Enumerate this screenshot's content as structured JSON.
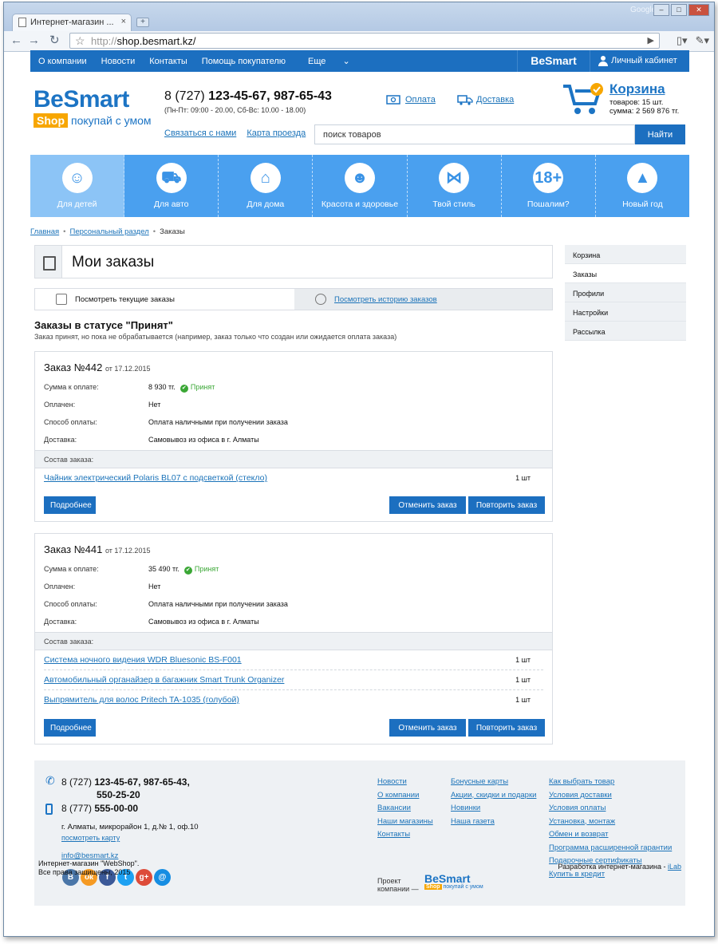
{
  "browser": {
    "tab_title": "Интернет-магазин ...",
    "profile": "Google",
    "url_protocol": "http://",
    "url_host": "shop.besmart.kz/"
  },
  "topnav": {
    "links": [
      "О компании",
      "Новости",
      "Контакты",
      "Помощь покупателю",
      "Еще"
    ],
    "brand": "BeSmart",
    "cabinet": "Личный кабинет"
  },
  "header": {
    "logo_main": "BeSmart",
    "logo_shop": "Shop",
    "logo_tagline": "покупай с умом",
    "phone_prefix": "8 (727)",
    "phone_numbers": "123-45-67, 987-65-43",
    "hours": "(Пн-Пт: 09:00 - 20.00, Сб-Вс: 10.00 - 18.00)",
    "contact_link": "Связаться с нами",
    "map_link": "Карта проезда",
    "payment_link": "Оплата",
    "delivery_link": "Доставка",
    "cart_title": "Корзина",
    "cart_count": "товаров: 15 шт.",
    "cart_sum": "сумма: 2 569 876 тг.",
    "search_placeholder": "поиск товаров",
    "search_button": "Найти"
  },
  "categories": [
    {
      "label": "Для детей",
      "icon": "baby-icon"
    },
    {
      "label": "Для авто",
      "icon": "car-icon"
    },
    {
      "label": "Для дома",
      "icon": "house-icon"
    },
    {
      "label": "Красота и здоровье",
      "icon": "beauty-icon"
    },
    {
      "label": "Твой стиль",
      "icon": "bowtie-icon"
    },
    {
      "label": "Пошалим?",
      "icon": "18plus-icon",
      "glyph": "18+"
    },
    {
      "label": "Новый год",
      "icon": "christmas-tree-icon"
    }
  ],
  "breadcrumb": [
    "Главная",
    "Персональный раздел",
    "Заказы"
  ],
  "page": {
    "title": "Мои заказы",
    "tab_current": "Посмотреть текущие заказы",
    "tab_history": "Посмотреть историю заказов",
    "status_title": "Заказы в статусе \"Принят\"",
    "status_desc": "Заказ принят, но пока не обрабатывается (например, заказ только что создан или ожидается оплата заказа)"
  },
  "order_labels": {
    "sum": "Сумма к оплате:",
    "paid": "Оплачен:",
    "method": "Способ оплаты:",
    "delivery": "Доставка:",
    "composition": "Состав заказа:",
    "details_button": "Подробнее",
    "cancel_button": "Отменить заказ",
    "repeat_button": "Повторить заказ"
  },
  "orders": [
    {
      "number": "Заказ №442",
      "date": "от 17.12.2015",
      "sum": "8 930 тг.",
      "status": "Принят",
      "paid": "Нет",
      "method": "Оплата наличными при получении заказа",
      "delivery": "Самовывоз из офиса в г. Алматы",
      "items": [
        {
          "name": "Чайник электрический Polaris BL07 с подсветкой (стекло)",
          "qty": "1 шт"
        }
      ]
    },
    {
      "number": "Заказ №441",
      "date": "от 17.12.2015",
      "sum": "35 490 тг.",
      "status": "Принят",
      "paid": "Нет",
      "method": "Оплата наличными при получении заказа",
      "delivery": "Самовывоз из офиса в г. Алматы",
      "items": [
        {
          "name": "Система ночного видения WDR Bluesonic BS-F001",
          "qty": "1 шт"
        },
        {
          "name": "Автомобильный органайзер в багажник Smart Trunk Organizer",
          "qty": "1 шт"
        },
        {
          "name": "Выпрямитель для волос Pritech TA-1035 (голубой)",
          "qty": "1 шт"
        }
      ]
    }
  ],
  "sidebar": [
    "Корзина",
    "Заказы",
    "Профили",
    "Настройки",
    "Рассылка"
  ],
  "footer": {
    "phone1_prefix": "8 (727)",
    "phone1_numbers": "123-45-67, 987-65-43,",
    "phone1_extra": "550-25-20",
    "phone2_prefix": "8 (777)",
    "phone2_number": "555-00-00",
    "address": "г. Алматы, микрорайон 1, д.№ 1, оф.10",
    "map_link": "посмотреть карту",
    "email": "info@besmart.kz",
    "socials": [
      {
        "name": "vk",
        "glyph": "В",
        "color": "#4a76a8"
      },
      {
        "name": "odnoklassniki",
        "glyph": "ок",
        "color": "#f59a23"
      },
      {
        "name": "facebook",
        "glyph": "f",
        "color": "#3b5998"
      },
      {
        "name": "twitter",
        "glyph": "t",
        "color": "#1da1f2"
      },
      {
        "name": "google-plus",
        "glyph": "g+",
        "color": "#dd4b39"
      },
      {
        "name": "mail",
        "glyph": "@",
        "color": "#168de2"
      }
    ],
    "col1": [
      "Новости",
      "О компании",
      "Вакансии",
      "Наши магазины",
      "Контакты"
    ],
    "col2": [
      "Бонусные карты",
      "Акции, скидки и подарки",
      "Новинки",
      "Наша газета"
    ],
    "col3": [
      "Как выбрать товар",
      "Условия доставки",
      "Условия оплаты",
      "Установка, монтаж",
      "Обмен и возврат",
      "Программа расширенной гарантии",
      "Подарочные сертификаты",
      "Купить в кредит"
    ],
    "project_label": "Проект компании —",
    "project_logo_main": "BeSmart",
    "project_logo_shop": "Shop",
    "project_logo_tag": "покупай с умом",
    "copyright_line1": "Интернет-магазин \"WebShop\".",
    "copyright_line2": "Все права защищены, 2015",
    "dev_text": "Разработка интернет-магазина - ",
    "dev_link": "iLab"
  }
}
